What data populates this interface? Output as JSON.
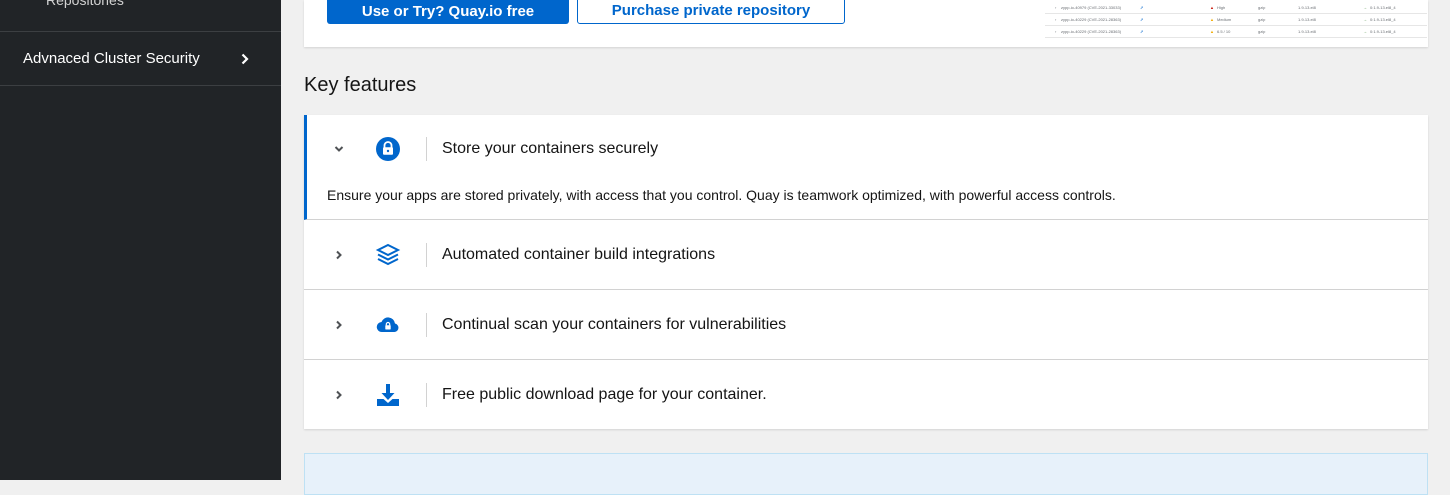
{
  "sidebar": {
    "partial_item_label": "Repositories",
    "item_label": "Advnaced Cluster Security"
  },
  "top_card": {
    "primary_button_label": "Use or Try? Quay.io free",
    "secondary_button_label": "Purchase private repository",
    "preview_rows": [
      {
        "cve": "zypp-io-40979 (CVE-2021-33033)",
        "severity": "High",
        "pkg": "gzip",
        "ver": "1.9-13.el8",
        "fixed": "0:1.9-13.el8_4"
      },
      {
        "cve": "zypp-io-40229 (CVE-2021-28363)",
        "severity": "Medium",
        "pkg": "gzip",
        "ver": "1.9-13.el8",
        "fixed": "0:1.9-13.el8_4"
      },
      {
        "cve": "zypp-io-40229 (CVE-2021-28363)",
        "severity": "6.5 / 10",
        "pkg": "gzip",
        "ver": "1.9-13.el8",
        "fixed": "0:1.9-13.el8_4"
      }
    ]
  },
  "key_features": {
    "title": "Key features",
    "items": [
      {
        "icon": "lock-icon",
        "label": "Store your containers securely",
        "expanded": true,
        "body": "Ensure your apps are stored privately, with access that you control. Quay is teamwork optimized, with powerful access controls."
      },
      {
        "icon": "layers-icon",
        "label": "Automated container build integrations",
        "expanded": false
      },
      {
        "icon": "cloud-lock-icon",
        "label": "Continual scan your containers for vulnerabilities",
        "expanded": false
      },
      {
        "icon": "download-icon",
        "label": "Free public download page for your container.",
        "expanded": false
      }
    ]
  },
  "colors": {
    "sidebar_bg": "#212427",
    "accent": "#0066cc",
    "page_bg": "#f0f0f0",
    "info_bg": "#e7f1fa"
  }
}
